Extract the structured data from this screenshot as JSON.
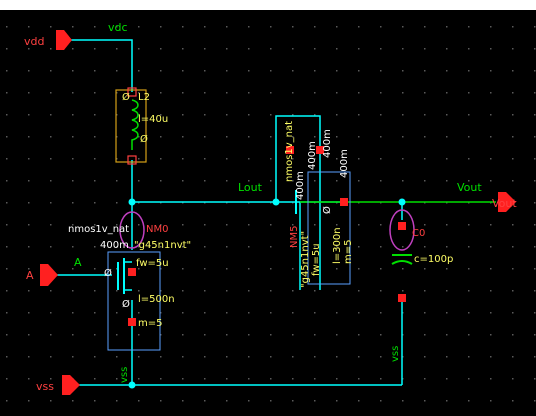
{
  "colors": {
    "background": "#000000",
    "grid_dot": "#5a5a5a",
    "wire": "#00ffff",
    "net_label": "#00e000",
    "pin": "#ff2020",
    "device": "#d4a017",
    "device_text": "#ffff66",
    "annotation": "#ff4040",
    "cell_text": "#5aa0ff",
    "instance_hl": "#c040c0"
  },
  "pins": {
    "vdd": "vdd",
    "vss": "vss",
    "a": "A",
    "vout": "Vout"
  },
  "nets": {
    "vdc": "vdc",
    "lout": "Lout",
    "a": "A",
    "vout": "Vout",
    "vss_left": "vss",
    "vss_right": "vss"
  },
  "inductor": {
    "name": "L2",
    "value": "l=40u",
    "param_a": "Ø",
    "param_b": "Ø"
  },
  "nmos_left": {
    "cell": "nmos1v_nat",
    "inst": "NM0",
    "width": "400m",
    "model": "\"g45n1nvt\"",
    "fw": "fw=5u",
    "l": "l=500n",
    "m": "m=5",
    "zero_a": "Ø",
    "zero_b": "Ø"
  },
  "nmos_right": {
    "cell": "nmos1v_nat",
    "inst": "NM5",
    "w1": "400m",
    "w2": "400m",
    "w3": "400m",
    "w4": "400m",
    "model": "\"g45n1nvt\"",
    "fw": "fw=5u",
    "l": "l=300n",
    "m": "m=5",
    "zero": "Ø"
  },
  "capacitor": {
    "name": "C0",
    "value": "c=100p"
  }
}
